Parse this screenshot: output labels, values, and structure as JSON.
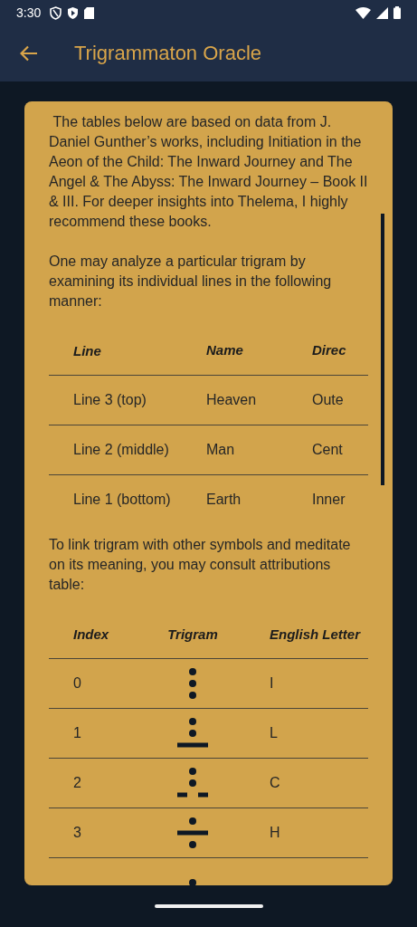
{
  "status_bar": {
    "time": "3:30"
  },
  "app_bar": {
    "title": "Trigrammaton Oracle"
  },
  "paragraphs": [
    " The tables below are based on data from J. Daniel Gunther’s works, including Initiation in the Aeon of the Child: The Inward Journey and The Angel & The Abyss: The Inward Journey – Book II & III. For deeper insights into Thelema, I highly recommend these books.",
    "One may analyze a particular trigram by examining its individual lines in the following manner:"
  ],
  "lines_table": {
    "columns": [
      "Line",
      "Name",
      "Direc"
    ],
    "rows": [
      {
        "cells": [
          "Line 3 (top)",
          "Heaven",
          "Oute"
        ]
      },
      {
        "cells": [
          "Line 2 (middle)",
          "Man",
          "Cent"
        ]
      },
      {
        "cells": [
          "Line 1 (bottom)",
          "Earth",
          "Inner"
        ]
      }
    ]
  },
  "attributions_intro": "To link trigram with other symbols and meditate on its meaning, you may consult attributions table:",
  "attributions_table": {
    "columns": [
      "Index",
      "Trigram",
      "English Letter"
    ],
    "rows": [
      {
        "index": "0",
        "trigram": [
          {
            "kind": "dot"
          },
          {
            "kind": "dot"
          },
          {
            "kind": "dot"
          }
        ],
        "letter": "I"
      },
      {
        "index": "1",
        "trigram": [
          {
            "kind": "dot"
          },
          {
            "kind": "dot"
          },
          {
            "kind": "solid"
          }
        ],
        "letter": "L"
      },
      {
        "index": "2",
        "trigram": [
          {
            "kind": "dot"
          },
          {
            "kind": "dot"
          },
          {
            "kind": "broken"
          }
        ],
        "letter": "C"
      },
      {
        "index": "3",
        "trigram": [
          {
            "kind": "dot"
          },
          {
            "kind": "solid"
          },
          {
            "kind": "dot"
          }
        ],
        "letter": "H"
      },
      {
        "trigram": [
          {
            "kind": "dot"
          }
        ]
      }
    ]
  }
}
